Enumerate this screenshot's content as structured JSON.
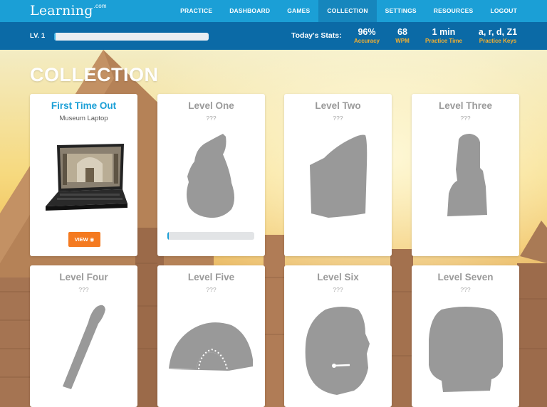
{
  "nav": {
    "logo_text": "Learning",
    "logo_suffix": ".com",
    "items": [
      "PRACTICE",
      "DASHBOARD",
      "GAMES",
      "COLLECTION",
      "SETTINGS",
      "RESOURCES",
      "LOGOUT"
    ],
    "active": "COLLECTION"
  },
  "stats": {
    "level_label": "LV. 1",
    "level_progress": 0.01,
    "today_label": "Today's Stats:",
    "items": [
      {
        "value": "96%",
        "label": "Accuracy"
      },
      {
        "value": "68",
        "label": "WPM"
      },
      {
        "value": "1 min",
        "label": "Practice Time"
      },
      {
        "value": "a, r, d, Z1",
        "label": "Practice Keys"
      }
    ]
  },
  "page": {
    "title": "COLLECTION"
  },
  "cards": [
    {
      "name": "First Time Out",
      "sub": "Museum Laptop",
      "unlocked": true,
      "button": "VIEW",
      "icon": "laptop-icon"
    },
    {
      "name": "Level One",
      "sub": "???",
      "progress": 0.02,
      "icon": "pharaoh-bust-silhouette"
    },
    {
      "name": "Level Two",
      "sub": "???",
      "icon": "rosetta-stone-silhouette"
    },
    {
      "name": "Level Three",
      "sub": "???",
      "icon": "moai-statue-silhouette"
    },
    {
      "name": "Level Four",
      "sub": "???",
      "icon": "baton-silhouette"
    },
    {
      "name": "Level Five",
      "sub": "???",
      "icon": "folding-fan-silhouette"
    },
    {
      "name": "Level Six",
      "sub": "???",
      "icon": "head-sculpture-silhouette"
    },
    {
      "name": "Level Seven",
      "sub": "???",
      "icon": "helmet-silhouette"
    }
  ],
  "colors": {
    "nav": "#1b9fd6",
    "nav_active": "#1686bd",
    "stats_bar": "#0b6aa6",
    "stat_label": "#f5b02f",
    "button": "#f47a20",
    "silhouette": "#999999"
  }
}
